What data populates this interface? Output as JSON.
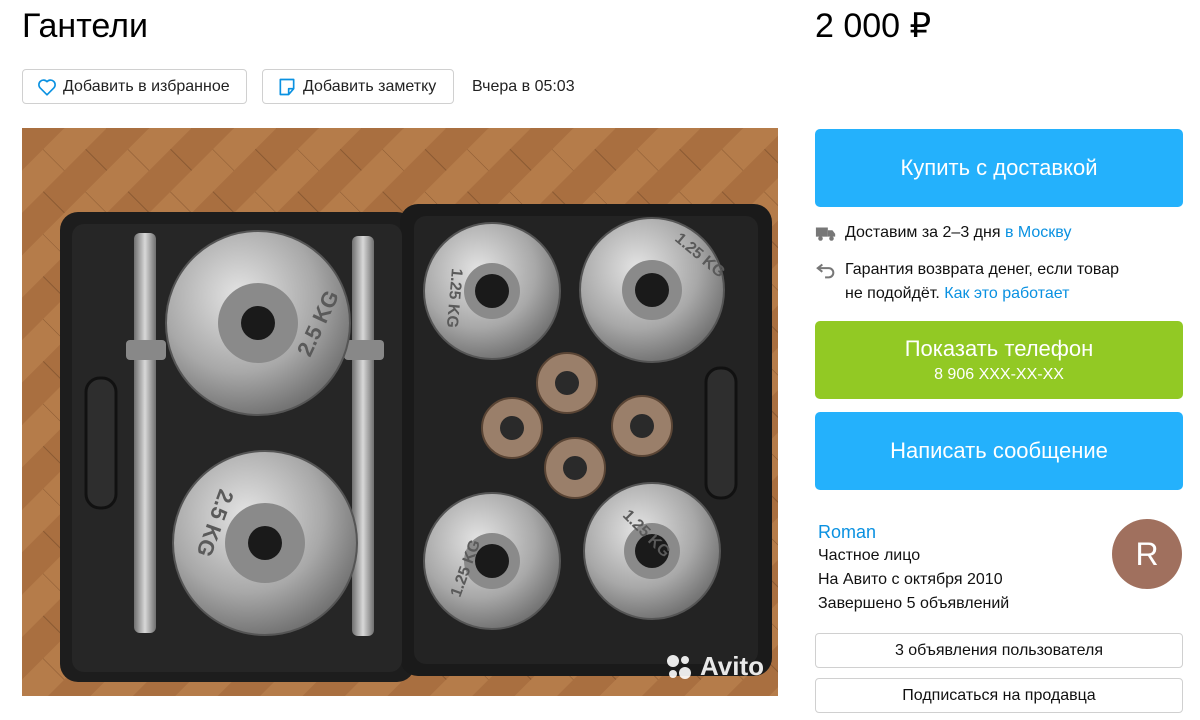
{
  "listing": {
    "title": "Гантели",
    "price": "2 000 ₽",
    "posted": "Вчера в 05:03"
  },
  "actions": {
    "favorite_label": "Добавить в избранное",
    "note_label": "Добавить заметку"
  },
  "photo": {
    "watermark": "Avito",
    "plate_labels": [
      "2.5 KG",
      "2.5 KG",
      "1.25 KG",
      "1.25 KG",
      "1.25 KG",
      "1.25 KG"
    ]
  },
  "buy": {
    "label": "Купить с доставкой"
  },
  "delivery": {
    "text": "Доставим за 2–3 дня ",
    "city_link": "в Москву"
  },
  "guarantee": {
    "line1": "Гарантия возврата денег, если товар",
    "line2": "не подойдёт. ",
    "link": "Как это работает"
  },
  "phone": {
    "label": "Показать телефон",
    "number": "8 906 XXX-XX-XX"
  },
  "message": {
    "label": "Написать сообщение"
  },
  "seller": {
    "name": "Roman",
    "type": "Частное лицо",
    "since": "На Авито с октября 2010",
    "completed": "Завершено 5 объявлений",
    "avatar_letter": "R"
  },
  "buttons": {
    "user_ads": "3 объявления пользователя",
    "subscribe": "Подписаться на продавца"
  },
  "colors": {
    "primary_blue": "#24b1fc",
    "phone_green": "#92c924",
    "link_blue": "#0a91e1",
    "avatar_brown": "#a0705e"
  }
}
